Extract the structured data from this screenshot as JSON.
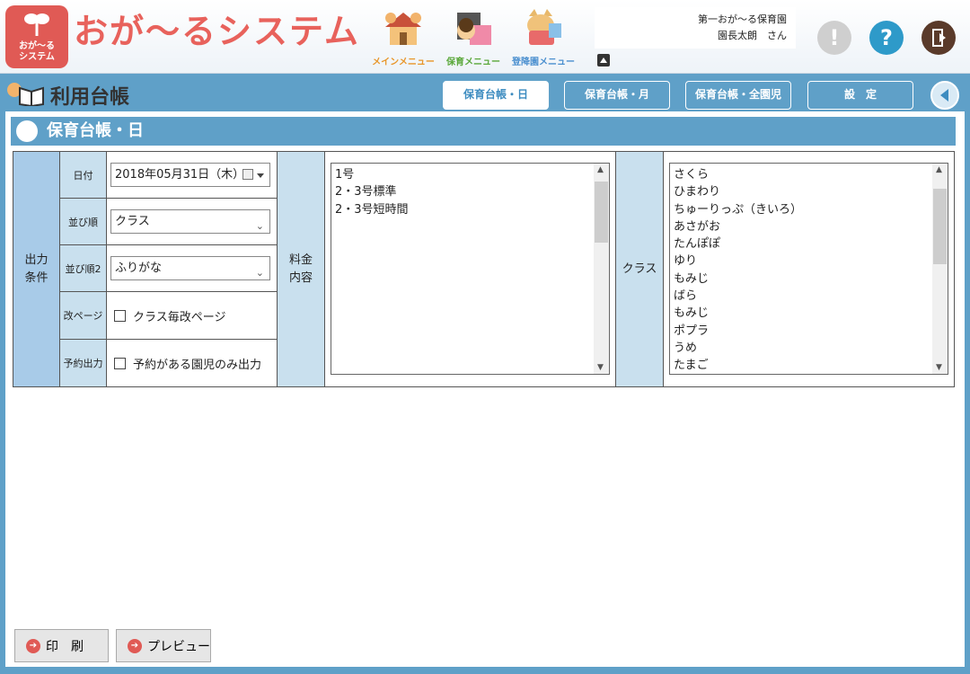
{
  "header": {
    "logo_text_1": "おが〜る",
    "logo_text_2": "システム",
    "app_title": "おが〜るシステム",
    "menu": [
      {
        "label": "メインメニュー",
        "icon": "house-icon",
        "color": "#e8962a"
      },
      {
        "label": "保育メニュー",
        "icon": "calendar-child-icon",
        "color": "#5aa83a"
      },
      {
        "label": "登降園メニュー",
        "icon": "cat-device-icon",
        "color": "#4a8fcf"
      }
    ],
    "facility": "第一おが〜る保育園",
    "user": "園長太朗　さん",
    "alert_icon": "alert-icon",
    "help_icon": "help-icon",
    "logout_icon": "logout-icon",
    "help_symbol": "?",
    "alert_symbol": "!"
  },
  "titlebar": {
    "title": "利用台帳",
    "tabs": [
      "保育台帳・日",
      "保育台帳・月",
      "保育台帳・全園児",
      "設　定"
    ],
    "active_tab": 0
  },
  "section": {
    "heading": "保育台帳・日"
  },
  "form": {
    "condition_label_1": "出力",
    "condition_label_2": "条件",
    "date_label": "日付",
    "date_value": "2018年05月31日（木）",
    "sort_label": "並び順",
    "sort_value": "クラス",
    "sort2_label": "並び順2",
    "sort2_value": "ふりがな",
    "page_label": "改ページ",
    "page_option": "クラス毎改ページ",
    "reserve_label": "予約出力",
    "reserve_option": "予約がある園児のみ出力",
    "fee_label_1": "料金",
    "fee_label_2": "内容",
    "fee_items": [
      "1号",
      "2・3号標準",
      "2・3号短時間"
    ],
    "class_label": "クラス",
    "class_items": [
      "さくら",
      "ひまわり",
      "ちゅーりっぷ（きいろ）",
      "あさがお",
      "たんぽぽ",
      "ゆり",
      "もみじ",
      "ばら",
      "もみじ",
      "ポプラ",
      "うめ",
      "たまご"
    ]
  },
  "actions": {
    "print": "印　刷",
    "preview": "プレビュー"
  },
  "colors": {
    "brand": "#e8625c",
    "accent": "#5fa0c8",
    "label_bg": "#c9e0ee",
    "condition_bg": "#a8cbe8"
  }
}
